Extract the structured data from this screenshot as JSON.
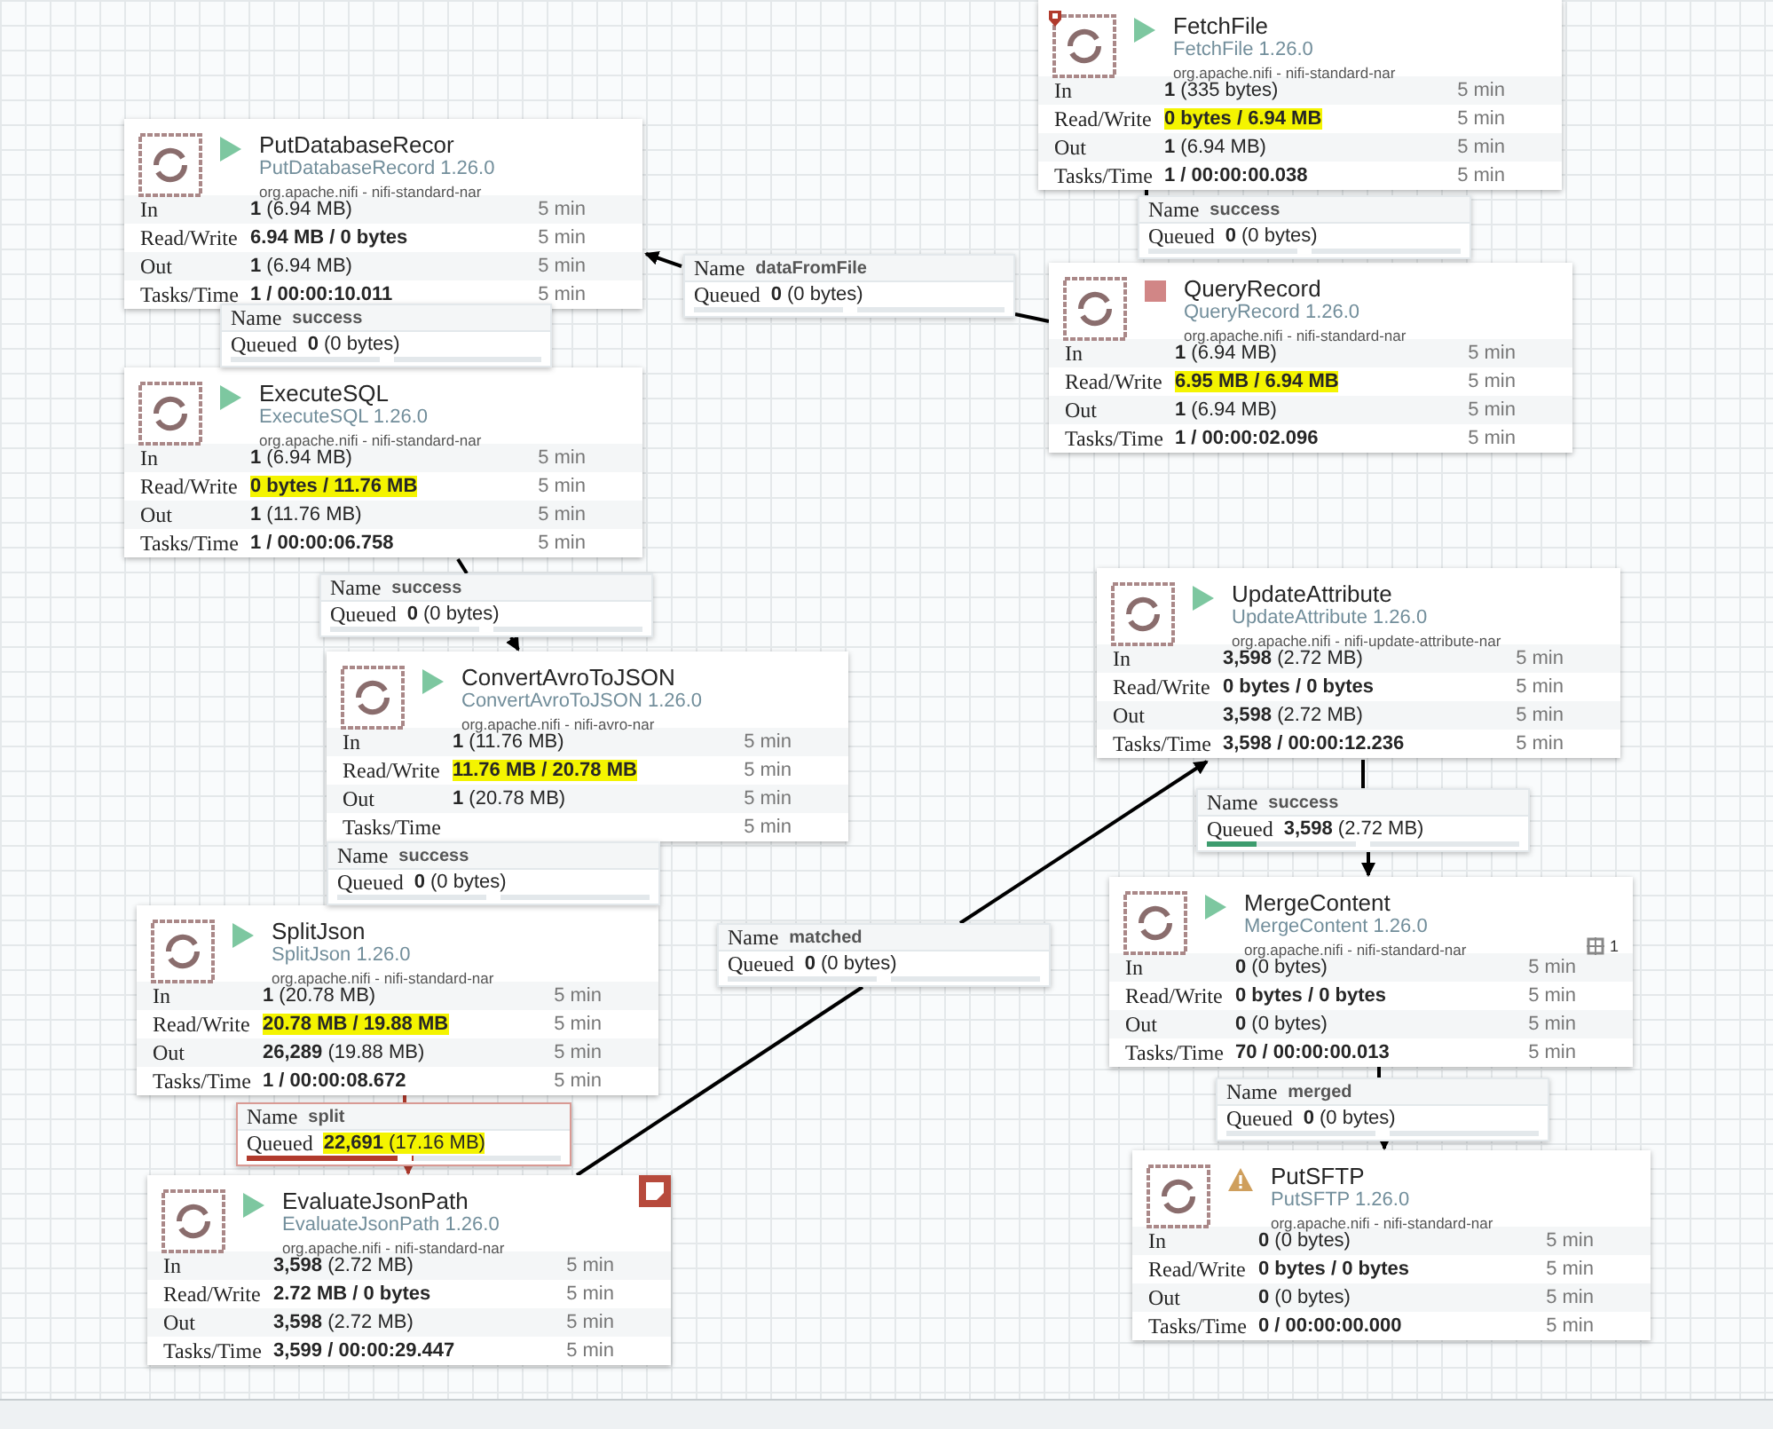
{
  "processors": [
    {
      "name": "FetchFile",
      "type": "FetchFile 1.26.0",
      "bundle": "org.apache.nifi - nifi-standard-nar",
      "kind": "running",
      "restricted": true,
      "stats": [
        {
          "kind": "count",
          "label": "In",
          "value": "**1** (335 bytes)",
          "time": "5 min"
        },
        {
          "kind": "total",
          "label": "Read/Write",
          "value": "0 bytes / 6.94 MB",
          "time": "5 min",
          "highlight": true
        },
        {
          "kind": "count",
          "label": "Out",
          "value": "**1** (6.94 MB)",
          "time": "5 min"
        },
        {
          "kind": "total",
          "label": "Tasks/Time",
          "value": "1 / 00:00:00.038",
          "time": "5 min"
        }
      ]
    },
    {
      "name": "PutDatabaseRecor",
      "type": "PutDatabaseRecord 1.26.0",
      "bundle": "org.apache.nifi - nifi-standard-nar",
      "kind": "running",
      "stats": [
        {
          "kind": "count",
          "label": "In",
          "value": "**1** (6.94 MB)",
          "time": "5 min"
        },
        {
          "kind": "total",
          "label": "Read/Write",
          "value": "6.94 MB / 0 bytes",
          "time": "5 min"
        },
        {
          "kind": "count",
          "label": "Out",
          "value": "**1** (6.94 MB)",
          "time": "5 min"
        },
        {
          "kind": "total",
          "label": "Tasks/Time",
          "value": "1 / 00:00:10.011",
          "time": "5 min"
        }
      ]
    },
    {
      "name": "ExecuteSQL",
      "type": "ExecuteSQL 1.26.0",
      "bundle": "org.apache.nifi - nifi-standard-nar",
      "kind": "running",
      "stats": [
        {
          "kind": "count",
          "label": "In",
          "value": "**1** (6.94 MB)",
          "time": "5 min"
        },
        {
          "kind": "total",
          "label": "Read/Write",
          "value": "0 bytes / 11.76 MB",
          "time": "5 min",
          "highlight": true
        },
        {
          "kind": "count",
          "label": "Out",
          "value": "**1** (11.76 MB)",
          "time": "5 min"
        },
        {
          "kind": "total",
          "label": "Tasks/Time",
          "value": "1 / 00:00:06.758",
          "time": "5 min"
        }
      ]
    },
    {
      "name": "QueryRecord",
      "type": "QueryRecord 1.26.0",
      "bundle": "org.apache.nifi - nifi-standard-nar",
      "kind": "stopped",
      "stats": [
        {
          "kind": "count",
          "label": "In",
          "value": "**1** (6.94 MB)",
          "time": "5 min"
        },
        {
          "kind": "total",
          "label": "Read/Write",
          "value": "6.95 MB / 6.94 MB",
          "time": "5 min",
          "highlight": true
        },
        {
          "kind": "count",
          "label": "Out",
          "value": "**1** (6.94 MB)",
          "time": "5 min"
        },
        {
          "kind": "total",
          "label": "Tasks/Time",
          "value": "1 / 00:00:02.096",
          "time": "5 min"
        }
      ]
    },
    {
      "name": "UpdateAttribute",
      "type": "UpdateAttribute 1.26.0",
      "bundle": "org.apache.nifi - nifi-update-attribute-nar",
      "kind": "running",
      "stats": [
        {
          "kind": "count",
          "label": "In",
          "value": "**3,598** (2.72 MB)",
          "time": "5 min"
        },
        {
          "kind": "total",
          "label": "Read/Write",
          "value": "0 bytes / 0 bytes",
          "time": "5 min"
        },
        {
          "kind": "count",
          "label": "Out",
          "value": "**3,598** (2.72 MB)",
          "time": "5 min"
        },
        {
          "kind": "total",
          "label": "Tasks/Time",
          "value": "3,598 / 00:00:12.236",
          "time": "5 min"
        }
      ]
    },
    {
      "name": "ConvertAvroToJSON",
      "type": "ConvertAvroToJSON 1.26.0",
      "bundle": "org.apache.nifi - nifi-avro-nar",
      "kind": "running",
      "stats": [
        {
          "kind": "count",
          "label": "In",
          "value": "**1** (11.76 MB)",
          "time": "5 min"
        },
        {
          "kind": "total",
          "label": "Read/Write",
          "value": "11.76 MB / 20.78 MB",
          "time": "5 min",
          "highlight": true
        },
        {
          "kind": "count",
          "label": "Out",
          "value": "**1** (20.78 MB)",
          "time": "5 min"
        },
        {
          "kind": "total",
          "label": "Tasks/Time",
          "time": "5 min"
        }
      ]
    },
    {
      "name": "SplitJson",
      "type": "SplitJson 1.26.0",
      "bundle": "org.apache.nifi - nifi-standard-nar",
      "kind": "running",
      "stats": [
        {
          "kind": "count",
          "label": "In",
          "value": "**1** (20.78 MB)",
          "time": "5 min"
        },
        {
          "kind": "total",
          "label": "Read/Write",
          "value": "20.78 MB / 19.88 MB",
          "time": "5 min",
          "highlight": true
        },
        {
          "kind": "count",
          "label": "Out",
          "value": "**26,289** (19.88 MB)",
          "time": "5 min"
        },
        {
          "kind": "total",
          "label": "Tasks/Time",
          "value": "1 / 00:00:08.672",
          "time": "5 min"
        }
      ]
    },
    {
      "name": "MergeContent",
      "type": "MergeContent 1.26.0",
      "bundle": "org.apache.nifi - nifi-standard-nar",
      "kind": "running",
      "active_threads": "1",
      "stats": [
        {
          "kind": "count",
          "label": "In",
          "value": "**0** (0 bytes)",
          "time": "5 min"
        },
        {
          "kind": "total",
          "label": "Read/Write",
          "value": "0 bytes / 0 bytes",
          "time": "5 min"
        },
        {
          "kind": "count",
          "label": "Out",
          "value": "**0** (0 bytes)",
          "time": "5 min"
        },
        {
          "kind": "total",
          "label": "Tasks/Time",
          "value": "70 / 00:00:00.013",
          "time": "5 min"
        }
      ]
    },
    {
      "name": "EvaluateJsonPath",
      "type": "EvaluateJsonPath 1.26.0",
      "bundle": "org.apache.nifi - nifi-standard-nar",
      "kind": "running",
      "bulletin": true,
      "stats": [
        {
          "kind": "count",
          "label": "In",
          "value": "**3,598** (2.72 MB)",
          "time": "5 min"
        },
        {
          "kind": "total",
          "label": "Read/Write",
          "value": "2.72 MB / 0 bytes",
          "time": "5 min"
        },
        {
          "kind": "count",
          "label": "Out",
          "value": "**3,598** (2.72 MB)",
          "time": "5 min"
        },
        {
          "kind": "total",
          "label": "Tasks/Time",
          "value": "3,599 / 00:00:29.447",
          "time": "5 min"
        }
      ]
    },
    {
      "name": "PutSFTP",
      "type": "PutSFTP 1.26.0",
      "bundle": "org.apache.nifi - nifi-standard-nar",
      "kind": "invalid",
      "stats": [
        {
          "kind": "count",
          "label": "In",
          "value": "**0** (0 bytes)",
          "time": "5 min"
        },
        {
          "kind": "total",
          "label": "Read/Write",
          "value": "0 bytes / 0 bytes",
          "time": "5 min"
        },
        {
          "kind": "count",
          "label": "Out",
          "value": "**0** (0 bytes)",
          "time": "5 min"
        },
        {
          "kind": "total",
          "label": "Tasks/Time",
          "value": "0 / 00:00:00.000",
          "time": "5 min"
        }
      ]
    }
  ],
  "connections": [
    {
      "name_label": "Name",
      "name": "success",
      "queued_label": "Queued",
      "queued": "**0** (0 bytes)",
      "count_bar": {
        "level": 0
      },
      "size_bar": {
        "level": 0
      }
    },
    {
      "name_label": "Name",
      "name": "dataFromFile",
      "queued_label": "Queued",
      "queued": "**0** (0 bytes)",
      "count_bar": {
        "level": 0
      },
      "size_bar": {
        "level": 0
      }
    },
    {
      "name_label": "Name",
      "name": "success",
      "queued_label": "Queued",
      "queued": "**0** (0 bytes)",
      "count_bar": {
        "level": 0
      },
      "size_bar": {
        "level": 0
      }
    },
    {
      "name_label": "Name",
      "name": "success",
      "queued_label": "Queued",
      "queued": "**0** (0 bytes)",
      "count_bar": {
        "level": 0
      },
      "size_bar": {
        "level": 0
      }
    },
    {
      "name_label": "Name",
      "name": "success",
      "queued_label": "Queued",
      "queued": "**3,598** (2.72 MB)",
      "count_bar": {
        "level": 0.33
      },
      "size_bar": {
        "level": 0
      }
    },
    {
      "name_label": "Name",
      "name": "success",
      "queued_label": "Queued",
      "queued": "**0** (0 bytes)",
      "count_bar": {
        "level": 0
      },
      "size_bar": {
        "level": 0
      }
    },
    {
      "name_label": "Name",
      "name": "matched",
      "queued_label": "Queued",
      "queued": "**0** (0 bytes)",
      "count_bar": {
        "level": 0
      },
      "size_bar": {
        "level": 0
      }
    },
    {
      "name_label": "Name",
      "name": "split",
      "queued_label": "Queued",
      "queued": "**22,691** (17.16 MB)",
      "backpressure": true,
      "highlight": true,
      "count_bar": {
        "level": 1
      },
      "size_bar": {
        "level": 0.02
      }
    },
    {
      "name_label": "Name",
      "name": "merged",
      "queued_label": "Queued",
      "queued": "**0** (0 bytes)",
      "count_bar": {
        "level": 0
      },
      "size_bar": {
        "level": 0
      }
    }
  ]
}
